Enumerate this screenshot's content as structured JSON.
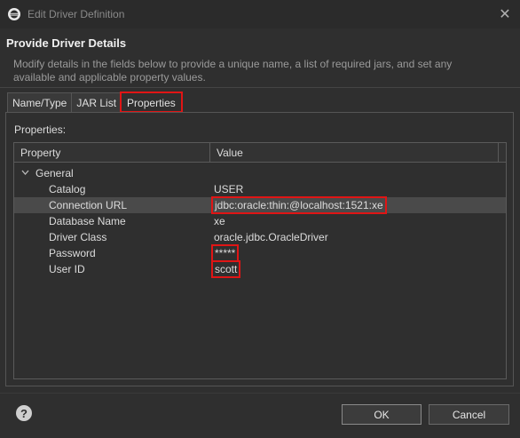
{
  "window": {
    "title": "Edit Driver Definition",
    "close_glyph": "✕"
  },
  "header": {
    "title": "Provide Driver Details",
    "description": "Modify details in the fields below to provide a unique name, a list of required jars, and set any available and applicable property values."
  },
  "tabs": [
    {
      "label": "Name/Type"
    },
    {
      "label": "JAR List"
    },
    {
      "label": "Properties",
      "active": true
    }
  ],
  "properties_label": "Properties:",
  "table": {
    "columns": [
      "Property",
      "Value"
    ],
    "group": "General",
    "rows": [
      {
        "property": "Catalog",
        "value": "USER"
      },
      {
        "property": "Connection URL",
        "value": "jdbc:oracle:thin:@localhost:1521:xe"
      },
      {
        "property": "Database Name",
        "value": "xe"
      },
      {
        "property": "Driver Class",
        "value": "oracle.jdbc.OracleDriver"
      },
      {
        "property": "Password",
        "value": "*****"
      },
      {
        "property": "User ID",
        "value": "scott"
      }
    ]
  },
  "buttons": {
    "ok": "OK",
    "cancel": "Cancel",
    "help": "?"
  },
  "colors": {
    "highlight": "#e01515",
    "background": "#2f2f2f"
  }
}
